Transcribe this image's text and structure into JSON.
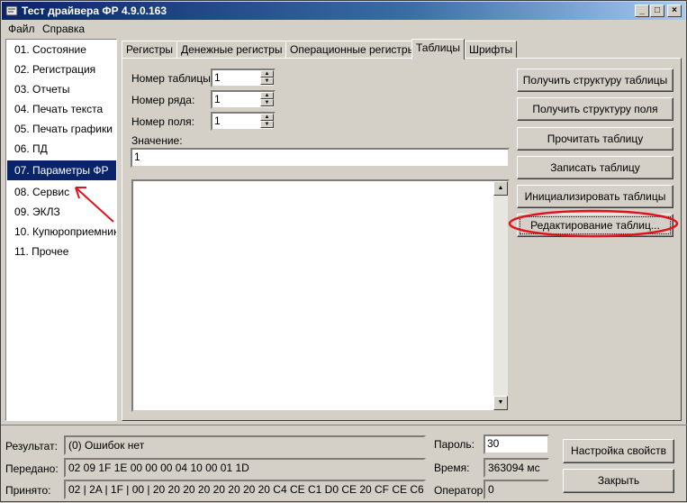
{
  "window": {
    "title": "Тест драйвера ФР 4.9.0.163"
  },
  "menu": [
    "Файл",
    "Справка"
  ],
  "sidebar": {
    "items": [
      {
        "label": "01. Состояние"
      },
      {
        "label": "02. Регистрация"
      },
      {
        "label": "03. Отчеты"
      },
      {
        "label": "04. Печать текста"
      },
      {
        "label": "05. Печать графики"
      },
      {
        "label": "06. ПД"
      },
      {
        "label": "07. Параметры ФР"
      },
      {
        "label": "08. Сервис"
      },
      {
        "label": "09. ЭКЛЗ"
      },
      {
        "label": "10. Купюроприемник"
      },
      {
        "label": "11. Прочее"
      }
    ],
    "selected_index": 6
  },
  "tabs": [
    "Регистры",
    "Денежные регистры",
    "Операционные регистры",
    "Таблицы",
    "Шрифты"
  ],
  "active_tab": "Таблицы",
  "form": {
    "table_label": "Номер таблицы:",
    "table_value": "1",
    "row_label": "Номер ряда:",
    "row_value": "1",
    "field_label": "Номер поля:",
    "field_value": "1",
    "value_label": "Значение:",
    "value_value": "1"
  },
  "buttons": {
    "get_table_structure": "Получить структуру таблицы",
    "get_field_structure": "Получить структуру поля",
    "read_table": "Прочитать таблицу",
    "write_table": "Записать таблицу",
    "init_tables": "Инициализировать таблицы",
    "edit_tables": "Редактирование таблиц...",
    "settings": "Настройка свойств",
    "close": "Закрыть"
  },
  "status": {
    "result_label": "Результат:",
    "result_value": "(0) Ошибок нет",
    "sent_label": "Передано:",
    "sent_value": "02 09 1F 1E 00 00 00 04 10 00 01 1D",
    "received_label": "Принято:",
    "received_value": "02 | 2A | 1F | 00 | 20 20 20 20 20 20 20 20 C4 CE C1 D0 CE 20 CF CE C6 C0 C",
    "password_label": "Пароль:",
    "password_value": "30",
    "time_label": "Время:",
    "time_value": "363094 мс",
    "operator_label": "Оператор:",
    "operator_value": "0"
  },
  "colors": {
    "annotation": "#e0141e",
    "selection": "#0a246a",
    "title_bar": "#0a246a"
  }
}
